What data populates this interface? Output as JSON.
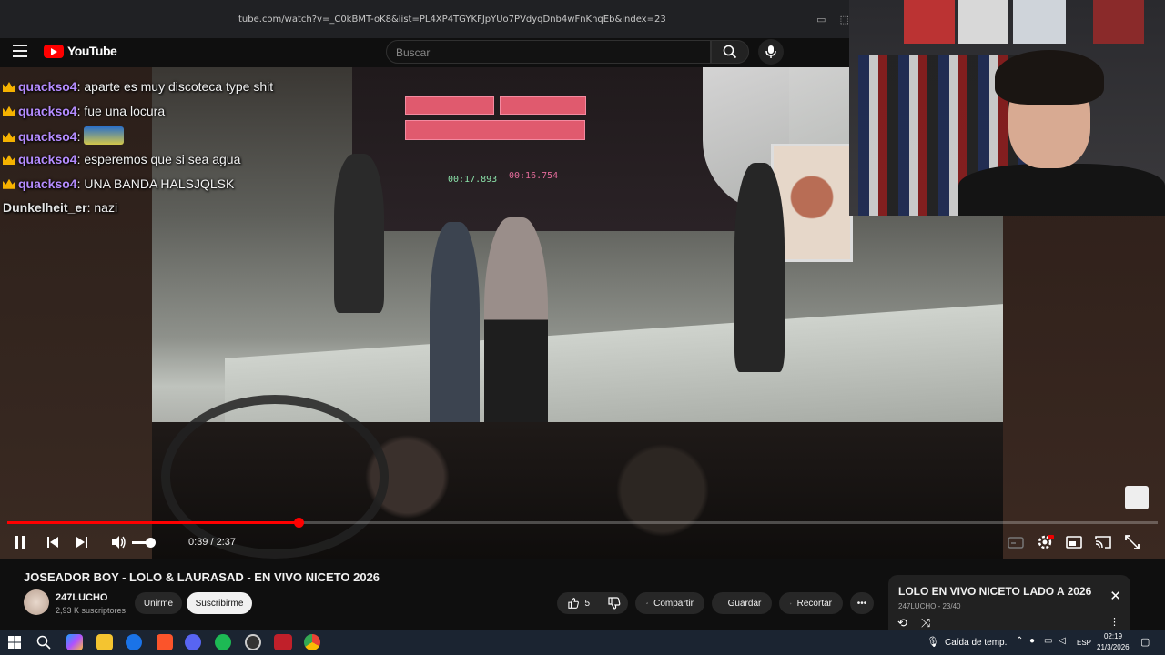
{
  "browser": {
    "url": "tube.com/watch?v=_C0kBMT-oK8&list=PL4XP4TGYKFJpYUo7PVdyqDnb4wFnKnqEb&index=23"
  },
  "header": {
    "logo_text": "YouTube",
    "search_placeholder": "Buscar"
  },
  "chat": [
    {
      "user": "quackso4",
      "message": "aparte es muy discoteca type shit",
      "crown": true
    },
    {
      "user": "quackso4",
      "message": "fue una locura",
      "crown": true
    },
    {
      "user": "quackso4",
      "message": "",
      "crown": true,
      "emote": "emote"
    },
    {
      "user": "quackso4",
      "message": "esperemos que si sea agua",
      "crown": true
    },
    {
      "user": "quackso4",
      "message": "UNA BANDA HALSJQLSK",
      "crown": true
    },
    {
      "user": "Dunkelheit_er",
      "message": "nazi",
      "crown": false
    }
  ],
  "player": {
    "progress_fraction": 0.253,
    "current_time": "0:39",
    "duration": "2:37",
    "time_display": "0:39 / 2:37",
    "volume_fraction": 0.75,
    "accent": "#ff0000"
  },
  "video": {
    "title": "JOSEADOR BOY - LOLO & LAURASAD - EN VIVO NICETO 2026",
    "channel": "247LUCHO",
    "subscribers": "2,93 K suscriptores",
    "unsubscribe_label": "Unirme",
    "subscribe_label": "Suscribirme",
    "likes": "5",
    "share_label": "Compartir",
    "save_label": "Guardar",
    "clip_label": "Recortar"
  },
  "playlist": {
    "title": "LOLO EN VIVO NICETO LADO A 2026",
    "subtitle": "247LUCHO - 23/40"
  },
  "taskbar": {
    "weather": "Caída de temp.",
    "lang": "ESP",
    "time": "02:19",
    "date": "21/3/2026"
  }
}
